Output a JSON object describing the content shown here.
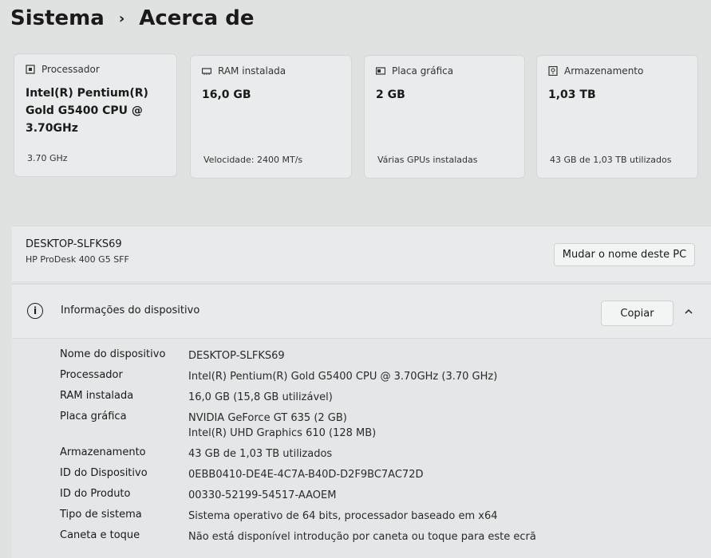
{
  "breadcrumb": {
    "parent": "Sistema",
    "current": "Acerca de"
  },
  "cards": [
    {
      "icon": "processor-icon",
      "title": "Processador",
      "value": "Intel(R) Pentium(R) Gold G5400 CPU @ 3.70GHz",
      "sub": "3.70 GHz"
    },
    {
      "icon": "ram-icon",
      "title": "RAM instalada",
      "value": "16,0 GB",
      "sub": "Velocidade: 2400 MT/s"
    },
    {
      "icon": "gpu-icon",
      "title": "Placa gráfica",
      "value": "2 GB",
      "sub": "Várias GPUs instaladas"
    },
    {
      "icon": "storage-icon",
      "title": "Armazenamento",
      "value": "1,03 TB",
      "sub": "43 GB de 1,03 TB utilizados"
    }
  ],
  "device": {
    "name": "DESKTOP-SLFKS69",
    "model": "HP ProDesk 400 G5 SFF",
    "rename_label": "Mudar o nome deste PC"
  },
  "specs": {
    "title": "Informações do dispositivo",
    "copy_label": "Copiar",
    "rows": [
      {
        "label": "Nome do dispositivo",
        "value": "DESKTOP-SLFKS69"
      },
      {
        "label": "Processador",
        "value": "Intel(R) Pentium(R) Gold G5400 CPU @ 3.70GHz (3.70 GHz)"
      },
      {
        "label": "RAM instalada",
        "value": "16,0 GB (15,8 GB utilizável)"
      },
      {
        "label": "Placa gráfica",
        "value": "NVIDIA GeForce GT 635 (2 GB)",
        "value2": "Intel(R) UHD Graphics 610 (128 MB)"
      },
      {
        "label": "Armazenamento",
        "value": "43 GB de 1,03 TB utilizados"
      },
      {
        "label": "ID do Dispositivo",
        "value": "0EBB0410-DE4E-4C7A-B40D-D2F9BC7AC72D"
      },
      {
        "label": "ID do Produto",
        "value": "00330-52199-54517-AAOEM"
      },
      {
        "label": "Tipo de sistema",
        "value": "Sistema operativo de 64 bits, processador baseado em x64"
      },
      {
        "label": "Caneta e toque",
        "value": "Não está disponível introdução por caneta ou toque para este ecrã"
      }
    ]
  }
}
